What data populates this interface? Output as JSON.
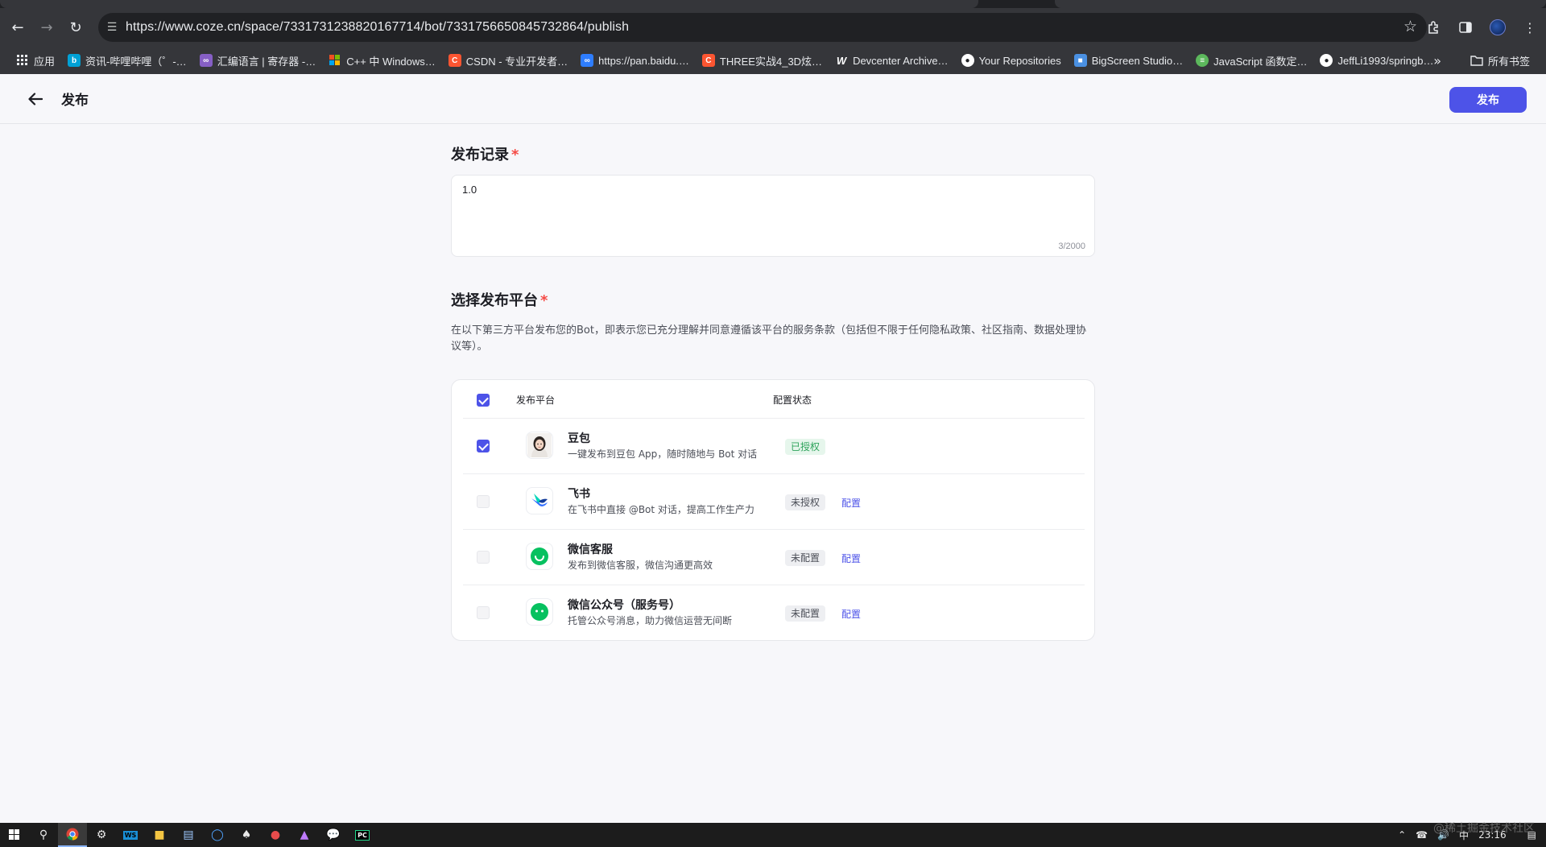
{
  "browser": {
    "url": "https://www.coze.cn/space/7331731238820167714/bot/7331756650845732864/publish",
    "bookmarks": [
      {
        "label": "应用",
        "icon": "apps-grid-icon",
        "color": "#e8eaed"
      },
      {
        "label": "资讯-哔哩哔哩（゜-…",
        "icon": "bilibili-icon",
        "color": "#00a1d6"
      },
      {
        "label": "汇编语言 | 寄存器 -…",
        "icon": "visual-studio-icon",
        "color": "#865fc5"
      },
      {
        "label": "C++ 中 Windows…",
        "icon": "windows-logo-icon",
        "color": "#f25022"
      },
      {
        "label": "CSDN - 专业开发者…",
        "icon": "csdn-icon",
        "color": "#fc5531"
      },
      {
        "label": "https://pan.baidu.…",
        "icon": "baidu-pan-icon",
        "color": "#2e7dfe"
      },
      {
        "label": "THREE实战4_3D炫…",
        "icon": "csdn-icon",
        "color": "#fc5531"
      },
      {
        "label": "Devcenter Archive…",
        "icon": "word-icon",
        "color": "#2b579a"
      },
      {
        "label": "Your Repositories",
        "icon": "github-icon",
        "color": "#ffffff"
      },
      {
        "label": "BigScreen Studio…",
        "icon": "bigscreen-icon",
        "color": "#4a90e2"
      },
      {
        "label": "JavaScript 函数定…",
        "icon": "green-globe-icon",
        "color": "#5cb85c"
      },
      {
        "label": "JeffLi1993/springb…",
        "icon": "github-icon",
        "color": "#ffffff"
      }
    ],
    "all_bookmarks_label": "所有书签"
  },
  "header": {
    "title": "发布",
    "publish_label": "发布"
  },
  "record": {
    "title": "发布记录",
    "required_mark": "*",
    "value": "1.0",
    "count": "3/2000"
  },
  "platforms": {
    "title": "选择发布平台",
    "required_mark": "*",
    "description": "在以下第三方平台发布您的Bot，即表示您已充分理解并同意遵循该平台的服务条款（包括但不限于任何隐私政策、社区指南、数据处理协议等）。",
    "col_platform": "发布平台",
    "col_status": "配置状态",
    "rows": [
      {
        "name": "豆包",
        "desc": "一键发布到豆包 App，随时随地与 Bot 对话",
        "status": "已授权",
        "status_type": "ok",
        "checked": true,
        "link": ""
      },
      {
        "name": "飞书",
        "desc": "在飞书中直接 @Bot 对话，提高工作生产力",
        "status": "未授权",
        "status_type": "no",
        "checked": false,
        "link": "配置"
      },
      {
        "name": "微信客服",
        "desc": "发布到微信客服，微信沟通更高效",
        "status": "未配置",
        "status_type": "no",
        "checked": false,
        "link": "配置"
      },
      {
        "name": "微信公众号（服务号）",
        "desc": "托管公众号消息，助力微信运营无间断",
        "status": "未配置",
        "status_type": "no",
        "checked": false,
        "link": "配置"
      }
    ]
  },
  "colors": {
    "accent": "#4d53e8",
    "required": "#f54a45",
    "ok_text": "#2ea35b"
  },
  "taskbar": {
    "ime": "中",
    "time": "23:16",
    "watermark": "@稀土掘金技术社区"
  }
}
